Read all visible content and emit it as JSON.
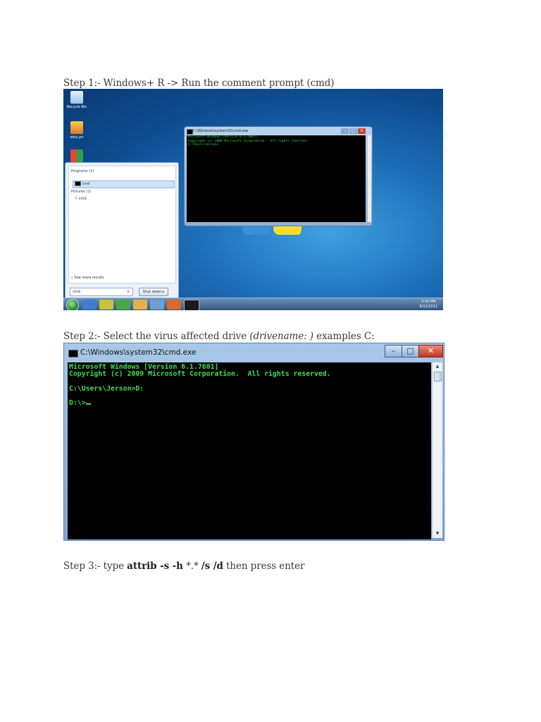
{
  "steps": {
    "step1": "Step 1:- Windows+ R -> Run the comment prompt (cmd)",
    "step2_prefix": "Step 2:- Select the virus affected drive ",
    "step2_italic": "(drivename: )",
    "step2_suffix": " examples C:",
    "step3_prefix": "Step 3:-  type ",
    "step3_cmd1": "attrib -s -h",
    "step3_mid": " *.* ",
    "step3_cmd2": "/s /d",
    "step3_suffix": " then press enter"
  },
  "screenshot1": {
    "desktop_icons": [
      {
        "label": "Recycle Bin",
        "icon": "recycle-bin-icon"
      },
      {
        "label": "sdsc.pn",
        "icon": "avast-icon"
      },
      {
        "label": "",
        "icon": "app-icon"
      }
    ],
    "start_menu": {
      "programs_header": "Programs (1)",
      "program_item": "cmd",
      "pictures_header": "Pictures (1)",
      "pictures_item": "cmd",
      "see_more": "See more results",
      "search_value": "cmd",
      "shutdown_label": "Shut down"
    },
    "window": {
      "title": "C:\\Windows\\system32\\cmd.exe",
      "lines": [
        "Microsoft Windows [Version 6.1.7601]",
        "Copyright (c) 2009 Microsoft Corporation.  All rights reserved.",
        "",
        "C:\\Users\\Jerson>"
      ]
    },
    "taskbar": {
      "time": "5:42 PM",
      "date": "8/22/2011"
    }
  },
  "screenshot2": {
    "title": "C:\\Windows\\system32\\cmd.exe",
    "console_lines": [
      "Microsoft Windows [Version 6.1.7601]",
      "Copyright (c) 2009 Microsoft Corporation.  All rights reserved.",
      "",
      "C:\\Users\\Jerson>D:",
      "",
      "D:\\>"
    ],
    "colors": {
      "console_text": "#3ce04f",
      "console_bg": "#000000"
    }
  }
}
